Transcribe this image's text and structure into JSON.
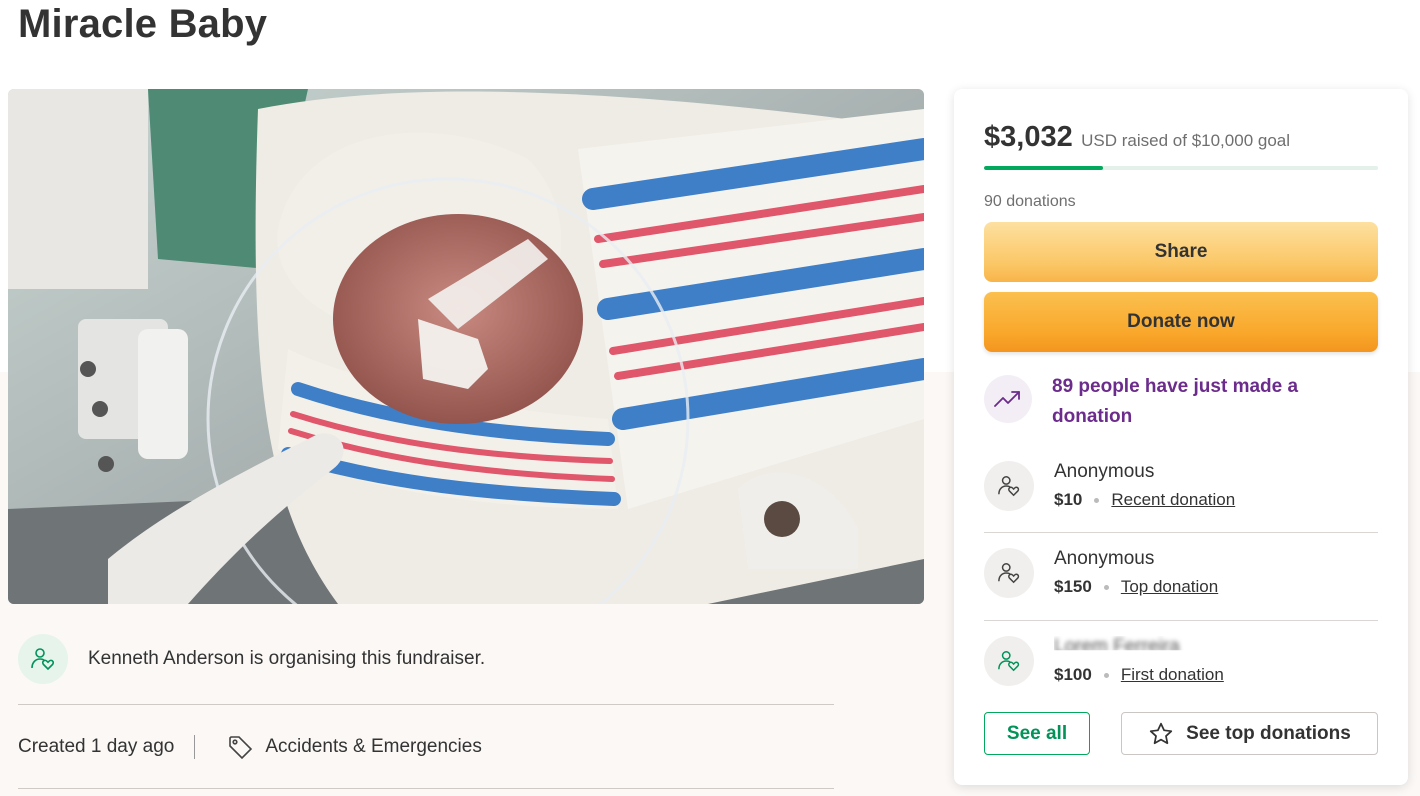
{
  "page": {
    "title": "Miracle Baby"
  },
  "fundraiser": {
    "organiser_text": "Kenneth Anderson is organising this fundraiser.",
    "created": "Created 1 day ago",
    "category": "Accidents & Emergencies"
  },
  "sidebar": {
    "amount": "$3,032",
    "goal_text": "USD raised of $10,000 goal",
    "progress_fraction": 0.3032,
    "donations_count": "90 donations",
    "share_label": "Share",
    "donate_label": "Donate now",
    "trend_text": "89 people have just made a donation",
    "donors": [
      {
        "name": "Anonymous",
        "amount": "$10",
        "tag": "Recent donation"
      },
      {
        "name": "Anonymous",
        "amount": "$150",
        "tag": "Top donation"
      },
      {
        "name": "Lorem Ferreira",
        "amount": "$100",
        "tag": "First donation"
      }
    ],
    "see_all_label": "See all",
    "see_top_label": "See top donations"
  },
  "colors": {
    "brand_green": "#02a95c",
    "trend_purple": "#6b2c8c",
    "donate_orange": "#f9a72a"
  },
  "icons": [
    "organiser-heart-icon",
    "tag-icon",
    "trend-up-icon",
    "donor-heart-icon",
    "star-icon"
  ]
}
